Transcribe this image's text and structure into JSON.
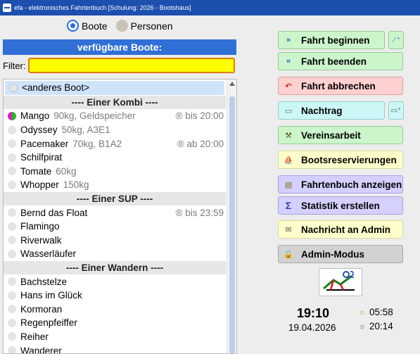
{
  "window": {
    "title": "efa - elektronisches Fahrtenbuch [Schulung: 2026 - Bootshaus]"
  },
  "mode_toggle": {
    "boats_label": "Boote",
    "persons_label": "Personen"
  },
  "list_header": "verfügbare Boote:",
  "filter": {
    "label": "Filter:",
    "value": ""
  },
  "list": {
    "selected": "<anderes Boot>",
    "groups": [
      {
        "title": "---- Einer Kombi ----",
        "items": [
          {
            "name": "Mango",
            "info": "90kg, Geldspeicher",
            "res": "® bis 20:00",
            "status": "split"
          },
          {
            "name": "Odyssey",
            "info": "50kg, A3E1",
            "res": ""
          },
          {
            "name": "Pacemaker",
            "info": "70kg, B1A2",
            "res": "® ab 20:00"
          },
          {
            "name": "Schilfpirat",
            "info": "",
            "res": ""
          },
          {
            "name": "Tomate",
            "info": "60kg",
            "res": ""
          },
          {
            "name": "Whopper",
            "info": "150kg",
            "res": ""
          }
        ]
      },
      {
        "title": "---- Einer SUP ----",
        "items": [
          {
            "name": "Bernd das Float",
            "info": "",
            "res": "® bis 23:59"
          },
          {
            "name": "Flamingo",
            "info": "",
            "res": ""
          },
          {
            "name": "Riverwalk",
            "info": "",
            "res": ""
          },
          {
            "name": "Wasserläufer",
            "info": "",
            "res": ""
          }
        ]
      },
      {
        "title": "---- Einer Wandern ----",
        "items": [
          {
            "name": "Bachstelze",
            "info": "",
            "res": ""
          },
          {
            "name": "Hans im Glück",
            "info": "",
            "res": ""
          },
          {
            "name": "Kormoran",
            "info": "",
            "res": ""
          },
          {
            "name": "Regenpfeiffer",
            "info": "",
            "res": ""
          },
          {
            "name": "Reiher",
            "info": "",
            "res": ""
          },
          {
            "name": "Wanderer",
            "info": "",
            "res": ""
          }
        ]
      }
    ]
  },
  "actions": {
    "start_trip": "Fahrt beginnen",
    "end_trip": "Fahrt beenden",
    "cancel_trip": "Fahrt abbrechen",
    "late_entry": "Nachtrag",
    "club_work": "Vereinsarbeit",
    "reservations": "Bootsreservierungen",
    "show_logbook": "Fahrtenbuch anzeigen",
    "statistics": "Statistik erstellen",
    "message_admin": "Nachricht an Admin",
    "admin_mode": "Admin-Modus"
  },
  "status": {
    "time": "19:10",
    "date": "19.04.2026",
    "sunrise": "05:58",
    "sunset": "20:14"
  },
  "colors": {
    "title_bar": "#1c4fae",
    "accent": "#2f6fd6",
    "filter_bg": "#ffff00",
    "filter_border": "#e07b10"
  }
}
